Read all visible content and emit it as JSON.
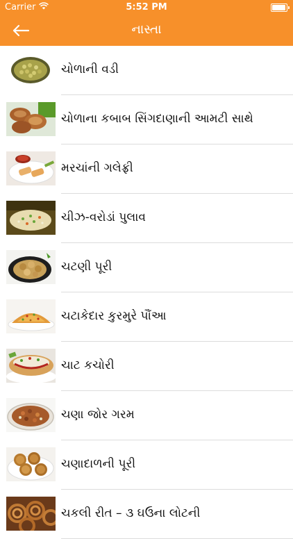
{
  "status_bar": {
    "carrier": "Carrier",
    "time": "5:52 PM",
    "signal_icon": "wifi-icon",
    "battery_icon": "battery-icon",
    "battery_level": 1.0
  },
  "nav": {
    "title": "નાસ્તા",
    "back_icon": "arrow-left-icon",
    "background_color": "#f7902a"
  },
  "items": [
    {
      "label": "ચોળાની વડી"
    },
    {
      "label": "ચોળાના કબાબ સિંગદાણાની આમટી સાથે"
    },
    {
      "label": "મરચાંની ગલેફ્રી"
    },
    {
      "label": "ચીઝ-વરોડાં પુલાવ"
    },
    {
      "label": "ચટણી પૂરી"
    },
    {
      "label": "ચટાકેદાર કુરમુરે પૌંઆ"
    },
    {
      "label": "ચાટ કચોરી"
    },
    {
      "label": "ચણા જોર ગરમ"
    },
    {
      "label": "ચણાદાળની પૂરી"
    },
    {
      "label": "ચકલી રીત – ૩ ઘઉંના લોટની"
    }
  ]
}
